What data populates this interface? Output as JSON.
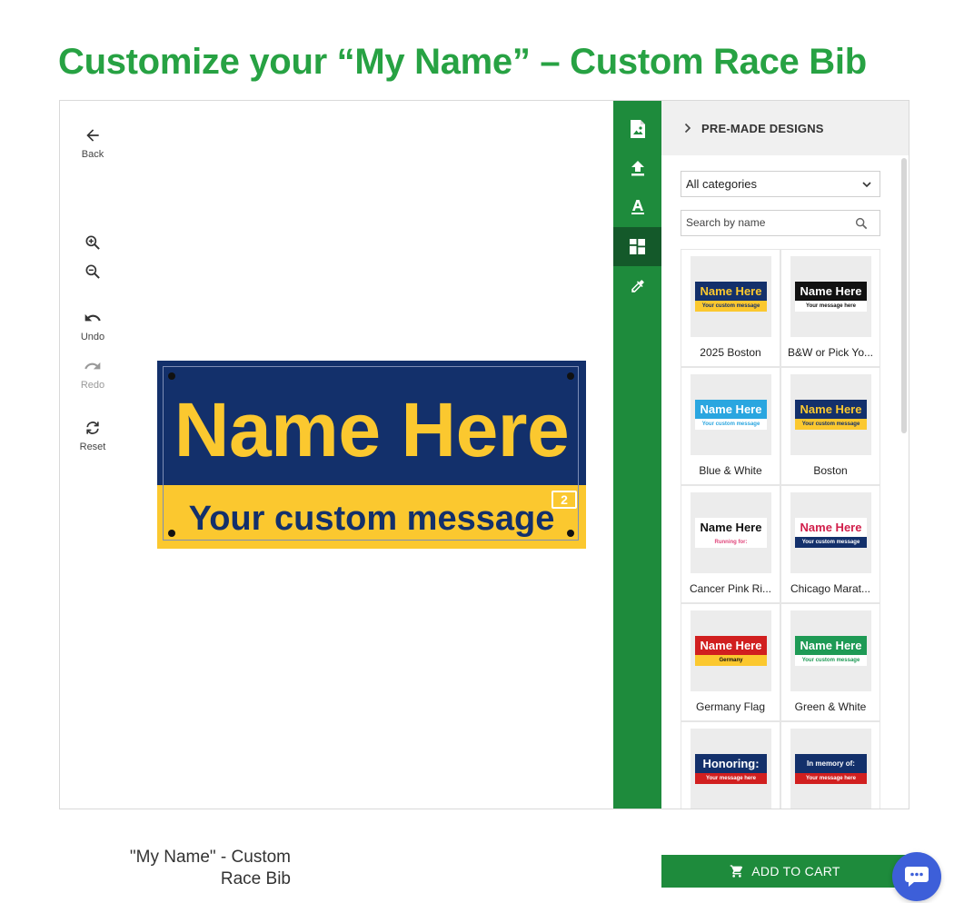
{
  "page": {
    "title": "Customize your “My Name” – Custom Race Bib"
  },
  "toolbar": {
    "back_label": "Back",
    "undo_label": "Undo",
    "redo_label": "Redo",
    "reset_label": "Reset"
  },
  "canvas": {
    "bib_name": "Name Here",
    "bib_message": "Your custom message",
    "resize_symbol": "2",
    "colors": {
      "top": "#13306b",
      "bottom": "#fbc82f"
    }
  },
  "rail": {
    "icons": [
      "image-file-icon",
      "upload-icon",
      "text-icon",
      "layout-icon",
      "color-picker-icon"
    ],
    "active": "layout-icon"
  },
  "panel": {
    "header": "PRE-MADE DESIGNS",
    "category_select": "All categories",
    "search_placeholder": "Search by name",
    "designs": [
      {
        "label": "2025 Boston",
        "top": "Name Here",
        "bottom": "Your custom message",
        "bg_top": "#13306b",
        "fg_top": "#fbc82f",
        "bg_bot": "#fbc82f",
        "fg_bot": "#13306b"
      },
      {
        "label": "B&W or Pick Yo...",
        "top": "Name Here",
        "bottom": "Your message here",
        "bg_top": "#111111",
        "fg_top": "#ffffff",
        "bg_bot": "#ffffff",
        "fg_bot": "#111111"
      },
      {
        "label": "Blue & White",
        "top": "Name Here",
        "bottom": "Your custom message",
        "bg_top": "#2aa6e0",
        "fg_top": "#ffffff",
        "bg_bot": "#ffffff",
        "fg_bot": "#2aa6e0"
      },
      {
        "label": "Boston",
        "top": "Name Here",
        "bottom": "Your custom message",
        "bg_top": "#13306b",
        "fg_top": "#fbc82f",
        "bg_bot": "#fbc82f",
        "fg_bot": "#13306b"
      },
      {
        "label": "Cancer Pink Ri...",
        "top": "Name Here",
        "bottom": "Running for:",
        "bg_top": "#ffffff",
        "fg_top": "#111111",
        "bg_bot": "#ffffff",
        "fg_bot": "#e0457b"
      },
      {
        "label": "Chicago Marat...",
        "top": "Name Here",
        "bottom": "Your custom message",
        "bg_top": "#ffffff",
        "fg_top": "#d11f4b",
        "bg_bot": "#13306b",
        "fg_bot": "#ffffff"
      },
      {
        "label": "Germany Flag",
        "top": "Name Here",
        "bottom": "Germany",
        "bg_top": "#d11f1f",
        "fg_top": "#ffffff",
        "bg_bot": "#fbc82f",
        "fg_bot": "#111111"
      },
      {
        "label": "Green & White",
        "top": "Name Here",
        "bottom": "Your custom message",
        "bg_top": "#1e9a55",
        "fg_top": "#ffffff",
        "bg_bot": "#ffffff",
        "fg_bot": "#1e9a55"
      },
      {
        "label": "",
        "top": "Honoring:",
        "bottom": "Your message here",
        "bg_top": "#13306b",
        "fg_top": "#ffffff",
        "bg_bot": "#d11f1f",
        "fg_bot": "#ffffff"
      },
      {
        "label": "",
        "top": "In memory of:",
        "bottom": "Your message here",
        "bg_top": "#13306b",
        "fg_top": "#ffffff",
        "bg_bot": "#d11f1f",
        "fg_bot": "#ffffff"
      }
    ]
  },
  "product": {
    "name": "\"My Name\" - Custom Race Bib"
  },
  "cart": {
    "label": "ADD TO CART"
  }
}
